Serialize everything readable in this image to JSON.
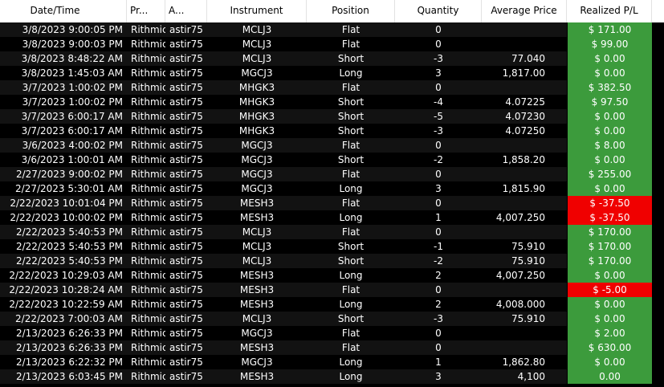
{
  "columns": {
    "datetime": "Date/Time",
    "provider": "Pr...",
    "account": "A...",
    "instrument": "Instrument",
    "position": "Position",
    "quantity": "Quantity",
    "avg_price": "Average Price",
    "realized_pl": "Realized P/L"
  },
  "colors": {
    "header_bg": "#ffffff",
    "row_bg": "#121212",
    "row_alt_bg": "#000000",
    "positive_pl": "#3c9b3c",
    "negative_pl": "#f00000"
  },
  "rows": [
    {
      "datetime": "3/8/2023 9:00:05 PM",
      "provider": "Rithmic",
      "account": "astir75",
      "instrument": "MCLJ3",
      "position": "Flat",
      "quantity": "0",
      "avg_price": "",
      "realized_pl": "$ 171.00",
      "pl_status": "positive"
    },
    {
      "datetime": "3/8/2023 9:00:03 PM",
      "provider": "Rithmic",
      "account": "astir75",
      "instrument": "MCLJ3",
      "position": "Flat",
      "quantity": "0",
      "avg_price": "",
      "realized_pl": "$ 99.00",
      "pl_status": "positive"
    },
    {
      "datetime": "3/8/2023 8:48:22 AM",
      "provider": "Rithmic",
      "account": "astir75",
      "instrument": "MCLJ3",
      "position": "Short",
      "quantity": "-3",
      "avg_price": "77.040",
      "realized_pl": "$ 0.00",
      "pl_status": "positive"
    },
    {
      "datetime": "3/8/2023 1:45:03 AM",
      "provider": "Rithmic",
      "account": "astir75",
      "instrument": "MGCJ3",
      "position": "Long",
      "quantity": "3",
      "avg_price": "1,817.00",
      "realized_pl": "$ 0.00",
      "pl_status": "positive"
    },
    {
      "datetime": "3/7/2023 1:00:02 PM",
      "provider": "Rithmic",
      "account": "astir75",
      "instrument": "MHGK3",
      "position": "Flat",
      "quantity": "0",
      "avg_price": "",
      "realized_pl": "$ 382.50",
      "pl_status": "positive"
    },
    {
      "datetime": "3/7/2023 1:00:02 PM",
      "provider": "Rithmic",
      "account": "astir75",
      "instrument": "MHGK3",
      "position": "Short",
      "quantity": "-4",
      "avg_price": "4.07225",
      "realized_pl": "$ 97.50",
      "pl_status": "positive"
    },
    {
      "datetime": "3/7/2023 6:00:17 AM",
      "provider": "Rithmic",
      "account": "astir75",
      "instrument": "MHGK3",
      "position": "Short",
      "quantity": "-5",
      "avg_price": "4.07230",
      "realized_pl": "$ 0.00",
      "pl_status": "positive"
    },
    {
      "datetime": "3/7/2023 6:00:17 AM",
      "provider": "Rithmic",
      "account": "astir75",
      "instrument": "MHGK3",
      "position": "Short",
      "quantity": "-3",
      "avg_price": "4.07250",
      "realized_pl": "$ 0.00",
      "pl_status": "positive"
    },
    {
      "datetime": "3/6/2023 4:00:02 PM",
      "provider": "Rithmic",
      "account": "astir75",
      "instrument": "MGCJ3",
      "position": "Flat",
      "quantity": "0",
      "avg_price": "",
      "realized_pl": "$ 8.00",
      "pl_status": "positive"
    },
    {
      "datetime": "3/6/2023 1:00:01 AM",
      "provider": "Rithmic",
      "account": "astir75",
      "instrument": "MGCJ3",
      "position": "Short",
      "quantity": "-2",
      "avg_price": "1,858.20",
      "realized_pl": "$ 0.00",
      "pl_status": "positive"
    },
    {
      "datetime": "2/27/2023 9:00:02 PM",
      "provider": "Rithmic",
      "account": "astir75",
      "instrument": "MGCJ3",
      "position": "Flat",
      "quantity": "0",
      "avg_price": "",
      "realized_pl": "$ 255.00",
      "pl_status": "positive"
    },
    {
      "datetime": "2/27/2023 5:30:01 AM",
      "provider": "Rithmic",
      "account": "astir75",
      "instrument": "MGCJ3",
      "position": "Long",
      "quantity": "3",
      "avg_price": "1,815.90",
      "realized_pl": "$ 0.00",
      "pl_status": "positive"
    },
    {
      "datetime": "2/22/2023 10:01:04 PM",
      "provider": "Rithmic",
      "account": "astir75",
      "instrument": "MESH3",
      "position": "Flat",
      "quantity": "0",
      "avg_price": "",
      "realized_pl": "$ -37.50",
      "pl_status": "negative"
    },
    {
      "datetime": "2/22/2023 10:00:02 PM",
      "provider": "Rithmic",
      "account": "astir75",
      "instrument": "MESH3",
      "position": "Long",
      "quantity": "1",
      "avg_price": "4,007.250",
      "realized_pl": "$ -37.50",
      "pl_status": "negative"
    },
    {
      "datetime": "2/22/2023 5:40:53 PM",
      "provider": "Rithmic",
      "account": "astir75",
      "instrument": "MCLJ3",
      "position": "Flat",
      "quantity": "0",
      "avg_price": "",
      "realized_pl": "$ 170.00",
      "pl_status": "positive"
    },
    {
      "datetime": "2/22/2023 5:40:53 PM",
      "provider": "Rithmic",
      "account": "astir75",
      "instrument": "MCLJ3",
      "position": "Short",
      "quantity": "-1",
      "avg_price": "75.910",
      "realized_pl": "$ 170.00",
      "pl_status": "positive"
    },
    {
      "datetime": "2/22/2023 5:40:53 PM",
      "provider": "Rithmic",
      "account": "astir75",
      "instrument": "MCLJ3",
      "position": "Short",
      "quantity": "-2",
      "avg_price": "75.910",
      "realized_pl": "$ 170.00",
      "pl_status": "positive"
    },
    {
      "datetime": "2/22/2023 10:29:03 AM",
      "provider": "Rithmic",
      "account": "astir75",
      "instrument": "MESH3",
      "position": "Long",
      "quantity": "2",
      "avg_price": "4,007.250",
      "realized_pl": "$ 0.00",
      "pl_status": "positive"
    },
    {
      "datetime": "2/22/2023 10:28:24 AM",
      "provider": "Rithmic",
      "account": "astir75",
      "instrument": "MESH3",
      "position": "Flat",
      "quantity": "0",
      "avg_price": "",
      "realized_pl": "$ -5.00",
      "pl_status": "negative"
    },
    {
      "datetime": "2/22/2023 10:22:59 AM",
      "provider": "Rithmic",
      "account": "astir75",
      "instrument": "MESH3",
      "position": "Long",
      "quantity": "2",
      "avg_price": "4,008.000",
      "realized_pl": "$ 0.00",
      "pl_status": "positive"
    },
    {
      "datetime": "2/22/2023 7:00:03 AM",
      "provider": "Rithmic",
      "account": "astir75",
      "instrument": "MCLJ3",
      "position": "Short",
      "quantity": "-3",
      "avg_price": "75.910",
      "realized_pl": "$ 0.00",
      "pl_status": "positive"
    },
    {
      "datetime": "2/13/2023 6:26:33 PM",
      "provider": "Rithmic",
      "account": "astir75",
      "instrument": "MGCJ3",
      "position": "Flat",
      "quantity": "0",
      "avg_price": "",
      "realized_pl": "$ 2.00",
      "pl_status": "positive"
    },
    {
      "datetime": "2/13/2023 6:26:33 PM",
      "provider": "Rithmic",
      "account": "astir75",
      "instrument": "MESH3",
      "position": "Flat",
      "quantity": "0",
      "avg_price": "",
      "realized_pl": "$ 630.00",
      "pl_status": "positive"
    },
    {
      "datetime": "2/13/2023 6:22:32 PM",
      "provider": "Rithmic",
      "account": "astir75",
      "instrument": "MGCJ3",
      "position": "Long",
      "quantity": "1",
      "avg_price": "1,862.80",
      "realized_pl": "$ 0.00",
      "pl_status": "positive"
    },
    {
      "datetime": "2/13/2023 6:03:45 PM",
      "provider": "Rithmic",
      "account": "astir75",
      "instrument": "MESH3",
      "position": "Long",
      "quantity": "3",
      "avg_price": "4,100",
      "realized_pl": "0.00",
      "pl_status": "positive"
    }
  ]
}
